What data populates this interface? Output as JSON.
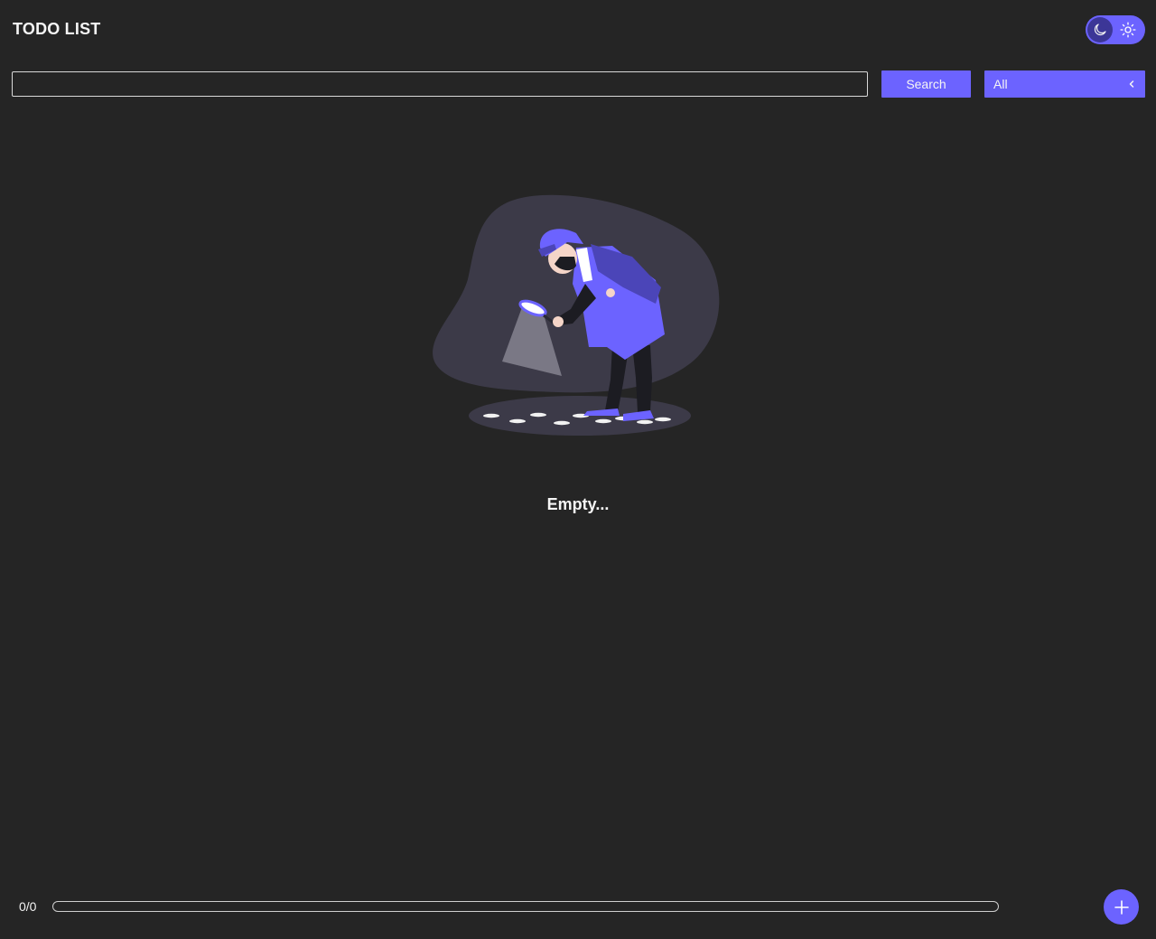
{
  "header": {
    "title": "TODO LIST"
  },
  "theme_toggle": {
    "mode": "dark",
    "icons": [
      "moon-icon",
      "sun-icon"
    ]
  },
  "search": {
    "value": "",
    "placeholder": "",
    "button_label": "Search"
  },
  "filter": {
    "selected": "All"
  },
  "empty_state": {
    "illustration": "detective-magnifying-glass-illustration",
    "text": "Empty..."
  },
  "progress": {
    "label": "0/0",
    "completed": 0,
    "total": 0,
    "fraction": 0
  },
  "add_button": {
    "icon": "plus-icon"
  },
  "colors": {
    "background": "#252525",
    "accent": "#6c63ff",
    "accent_dark": "#3c3697",
    "text": "#f2f2f2"
  }
}
